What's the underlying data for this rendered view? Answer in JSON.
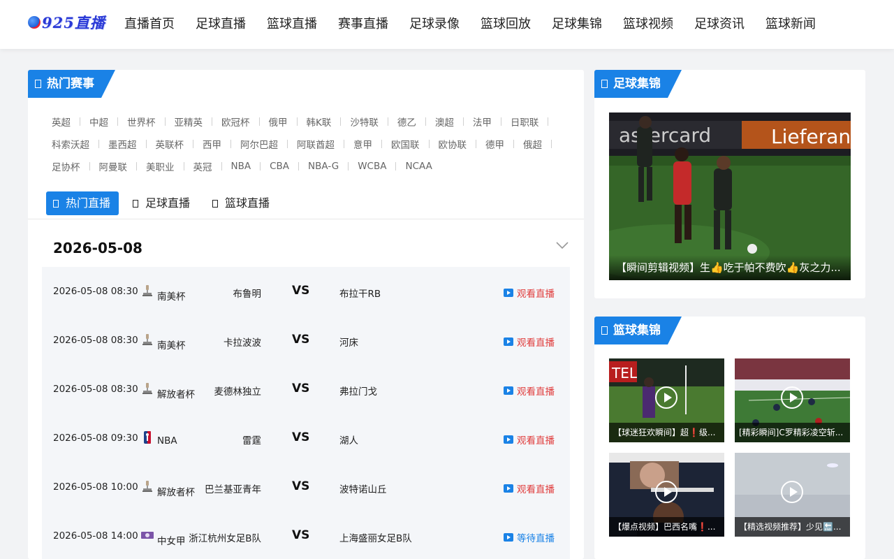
{
  "header": {
    "logo_text": "925直播",
    "nav": [
      "直播首页",
      "足球直播",
      "篮球直播",
      "赛事直播",
      "足球录像",
      "篮球回放",
      "足球集锦",
      "篮球视频",
      "足球资讯",
      "篮球新闻"
    ]
  },
  "hot_events": {
    "title": "热门赛事",
    "tag_rows": [
      [
        "英超",
        "中超",
        "世界杯",
        "亚精英",
        "欧冠杯",
        "俄甲",
        "韩K联",
        "沙特联",
        "德乙",
        "澳超",
        "法甲",
        "日职联"
      ],
      [
        "科索沃超",
        "墨西超",
        "英联杯",
        "西甲",
        "阿尔巴超",
        "阿联酋超",
        "意甲",
        "欧国联",
        "欧协联",
        "德甲",
        "俄超"
      ],
      [
        "足协杯",
        "阿曼联",
        "美职业",
        "英冠",
        "NBA",
        "CBA",
        "NBA-G",
        "WCBA",
        "NCAA"
      ]
    ]
  },
  "tabs": [
    {
      "label": "热门直播",
      "active": true
    },
    {
      "label": "足球直播",
      "active": false
    },
    {
      "label": "篮球直播",
      "active": false
    }
  ],
  "date": "2026-05-08",
  "matches": [
    {
      "time": "2026-05-08 08:30",
      "league": "南美杯",
      "icon": "trophy-icon",
      "home": "布鲁明",
      "vs": "VS",
      "away": "布拉干RB",
      "action": "观看直播",
      "status": "live"
    },
    {
      "time": "2026-05-08 08:30",
      "league": "南美杯",
      "icon": "trophy-icon",
      "home": "卡拉波波",
      "vs": "VS",
      "away": "河床",
      "action": "观看直播",
      "status": "live"
    },
    {
      "time": "2026-05-08 08:30",
      "league": "解放者杯",
      "icon": "trophy-icon",
      "home": "麦德林独立",
      "vs": "VS",
      "away": "弗拉门戈",
      "action": "观看直播",
      "status": "live"
    },
    {
      "time": "2026-05-08 09:30",
      "league": "NBA",
      "icon": "nba-logo-icon",
      "home": "雷霆",
      "vs": "VS",
      "away": "湖人",
      "action": "观看直播",
      "status": "live"
    },
    {
      "time": "2026-05-08 10:00",
      "league": "解放者杯",
      "icon": "trophy-icon",
      "home": "巴兰基亚青年",
      "vs": "VS",
      "away": "波特诺山丘",
      "action": "观看直播",
      "status": "live"
    },
    {
      "time": "2026-05-08 14:00",
      "league": "中女甲",
      "icon": "league-badge-icon",
      "home": "浙江杭州女足B队",
      "vs": "VS",
      "away": "上海盛丽女足B队",
      "action": "等待直播",
      "status": "waiting"
    }
  ],
  "football_highlights": {
    "title": "足球集锦",
    "hero_caption": "【瞬间剪辑视频】生👍吃于帕不费吹👍灰之力..."
  },
  "basketball_highlights": {
    "title": "篮球集锦",
    "videos": [
      {
        "caption": "【球迷狂欢瞬间】超❗级..."
      },
      {
        "caption": "[精彩瞬间]C罗精彩凌空斩..."
      },
      {
        "caption": "【爆点视频】巴西名嘴❗️..."
      },
      {
        "caption": "【精选视频推荐】少见🔚..."
      }
    ]
  },
  "colors": {
    "accent": "#1a82e6",
    "live_action": "#e03c3c",
    "waiting_action": "#1a82e6"
  }
}
